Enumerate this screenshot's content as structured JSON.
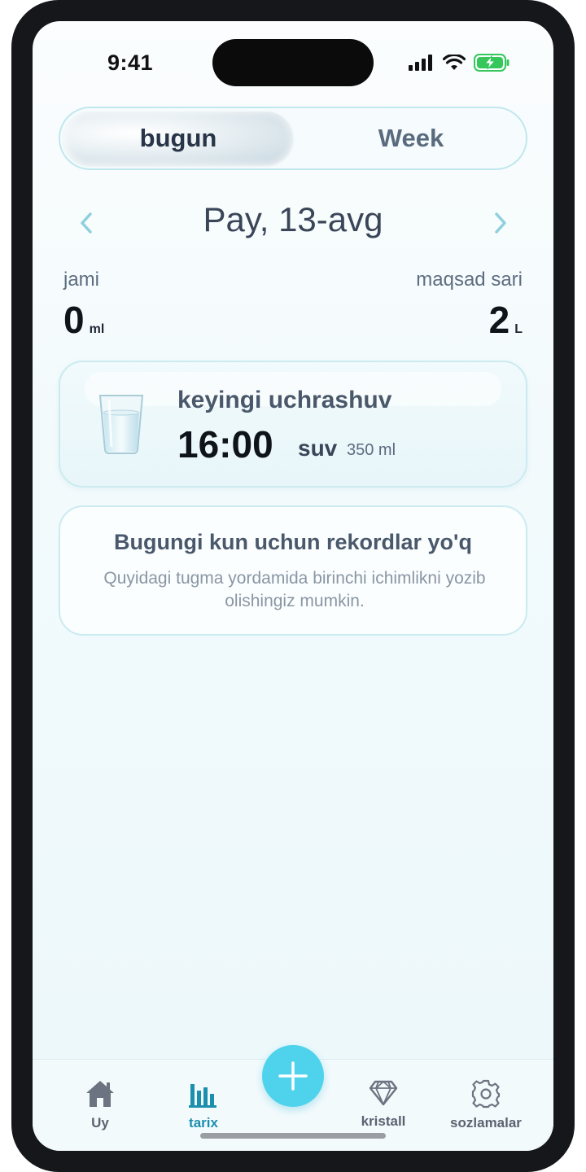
{
  "status_bar": {
    "time": "9:41"
  },
  "segment": {
    "active_label": "bugun",
    "inactive_label": "Week"
  },
  "date_nav": {
    "title": "Pay, 13-avg"
  },
  "totals": {
    "total_label": "jami",
    "total_value": "0",
    "total_unit": "ml",
    "goal_label": "maqsad sari",
    "goal_value": "2",
    "goal_unit": "L"
  },
  "next_reminder": {
    "label": "keyingi uchrashuv",
    "time": "16:00",
    "drink": "suv",
    "amount": "350 ml"
  },
  "empty_state": {
    "title": "Bugungi kun uchun rekordlar yo'q",
    "subtitle": "Quyidagi tugma yordamida birinchi ichimlikni yozib olishingiz mumkin."
  },
  "tabbar": {
    "items": [
      {
        "label": "Uy",
        "icon": "home-icon",
        "active": false
      },
      {
        "label": "tarix",
        "icon": "bar-chart-icon",
        "active": true
      },
      {
        "label": "kristall",
        "icon": "diamond-icon",
        "active": false
      },
      {
        "label": "sozlamalar",
        "icon": "gear-icon",
        "active": false
      }
    ],
    "fab_icon": "plus-icon"
  },
  "colors": {
    "accent": "#4fd3ec",
    "active_tab": "#1b8fae",
    "battery": "#35c759"
  }
}
